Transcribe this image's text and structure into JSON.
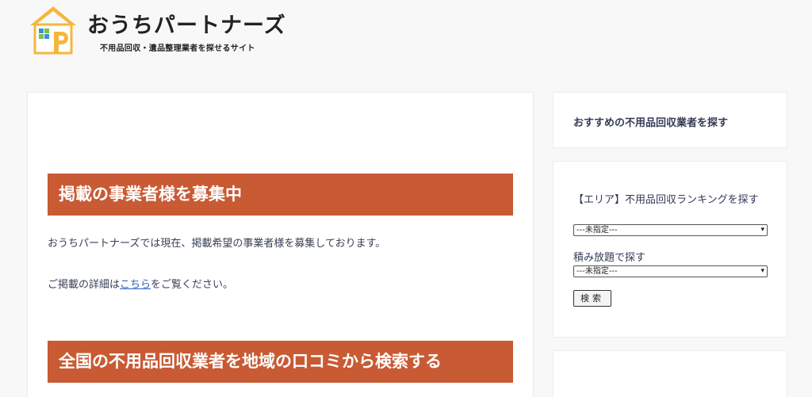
{
  "header": {
    "site_name": "おうちパートナーズ",
    "tagline": "不用品回収・遺品整理業者を探せるサイト"
  },
  "main": {
    "heading_recruit": "掲載の事業者様を募集中",
    "recruit_text": "おうちパートナーズでは現在、掲載希望の事業者様を募集しております。",
    "details_prefix": "ご掲載の詳細は",
    "details_link": "こちら",
    "details_suffix": "をご覧ください。",
    "heading_search": "全国の不用品回収業者を地域の口コミから検索する"
  },
  "sidebar": {
    "recommend_title": "おすすめの不用品回収業者を探す",
    "area_label": "【エリア】不用品回収ランキングを探す",
    "area_select_value": "---未指定---",
    "flatrate_label": "積み放題で探す",
    "flatrate_select_value": "---未指定---",
    "search_button": "検索"
  },
  "colors": {
    "heading_bg": "#c85a34",
    "logo_yellow": "#f5b73b",
    "link": "#2a5ec4"
  }
}
